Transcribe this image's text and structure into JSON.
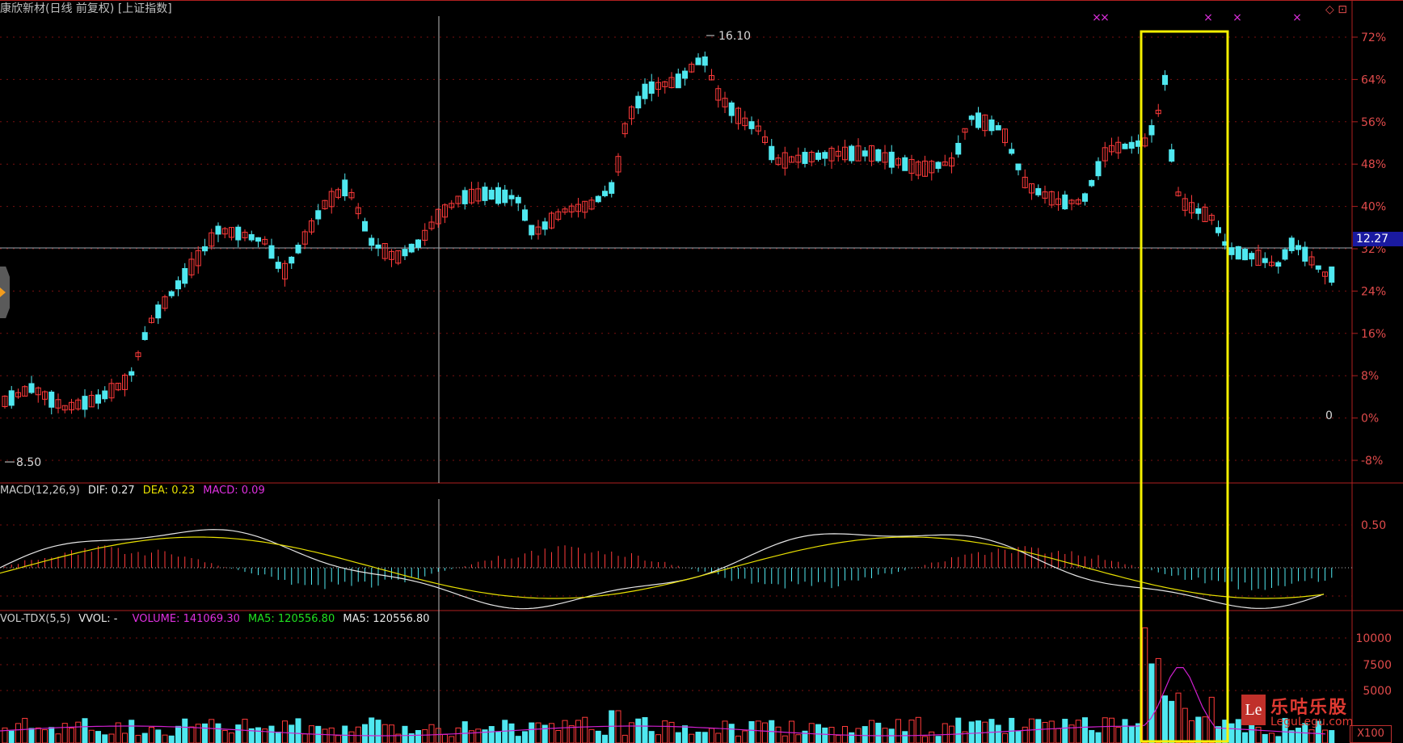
{
  "header": {
    "title": "康欣新材(日线 前复权) [上证指数]",
    "corner_icons": "◇ ⊡"
  },
  "price_panel": {
    "high_label": "16.10",
    "low_label": "8.50",
    "current_price": "12.27",
    "zero_marker": "0",
    "y_ticks": [
      "72%",
      "64%",
      "56%",
      "48%",
      "40%",
      "32%",
      "24%",
      "16%",
      "8%",
      "0%",
      "-8%"
    ]
  },
  "macd_panel": {
    "name": "MACD(12,26,9)",
    "dif": "DIF: 0.27",
    "dea": "DEA: 0.23",
    "macd": "MACD: 0.09",
    "y_tick": "0.50"
  },
  "volume_panel": {
    "name": "VOL-TDX(5,5)",
    "vvol": "VVOL: -",
    "volume": "VOLUME: 141069.30",
    "ma5_a": "MA5: 120556.80",
    "ma5_b": "MA5: 120556.80",
    "y_ticks": [
      "10000",
      "7500",
      "5000"
    ],
    "unit": "X100"
  },
  "watermark": {
    "logo": "Le",
    "title": "乐咕乐股",
    "site": "LeguLegu.com"
  },
  "colors": {
    "up": "#ff3a3a",
    "down": "#4fe8f0",
    "grid": "#7a1010",
    "highlight": "#f5f000",
    "dif_line": "#e6e6e6",
    "dea_line": "#e8e000",
    "macd": "#e030e0",
    "ma5": "#d020d0"
  }
}
